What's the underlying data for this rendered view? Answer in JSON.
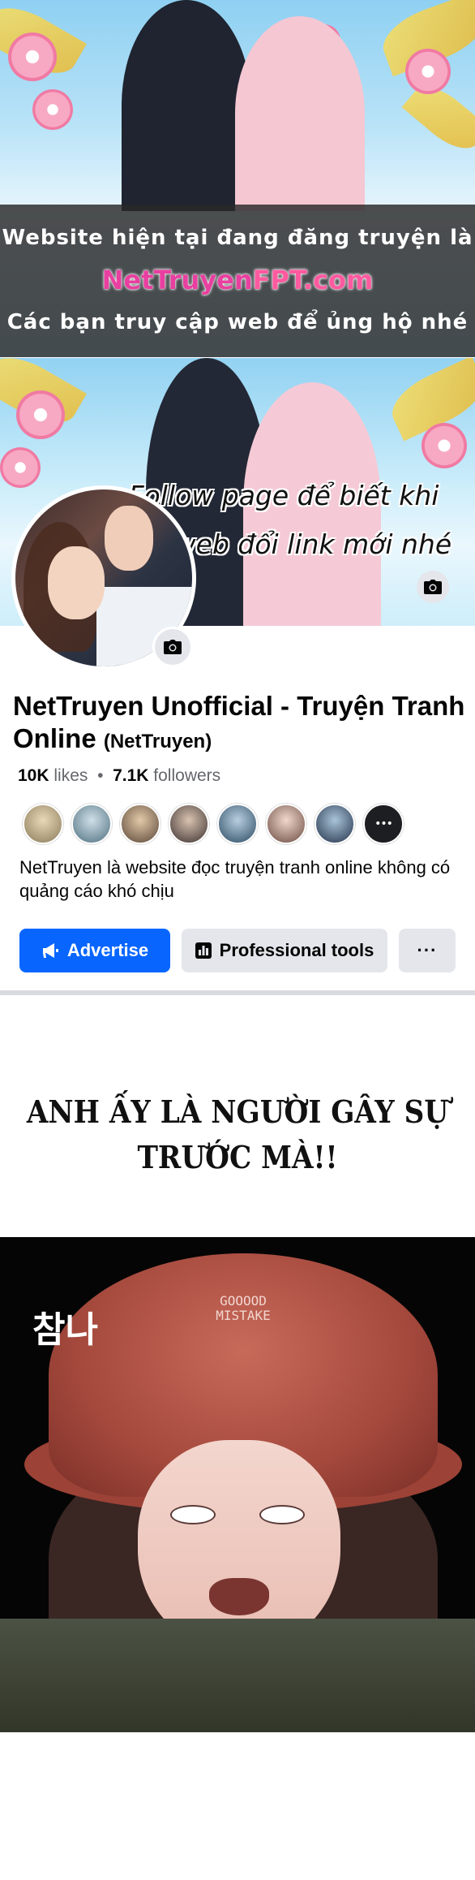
{
  "banner": {
    "line1": "Website hiện tại đang đăng truyện là",
    "brand_part1": "NetTruyen",
    "brand_part2": "FPT.com",
    "line3": "Các bạn truy cập web để ủng hộ nhé"
  },
  "fb_card": {
    "cover_text_line1": "Follow page để biết khi",
    "cover_text_line2": "nào web đổi link mới nhé",
    "page_name": "NetTruyen Unofficial - Truyện Tranh Online",
    "page_handle": "(NetTruyen)",
    "likes_count": "10K",
    "likes_label": "likes",
    "separator": "•",
    "followers_count": "7.1K",
    "followers_label": "followers",
    "more_friends_glyph": "•••",
    "bio": "NetTruyen là website đọc truyện tranh online không có quảng cáo khó chịu",
    "advertise_label": "Advertise",
    "professional_tools_label": "Professional tools",
    "more_glyph": "···",
    "brand_color": "#0866ff"
  },
  "comic": {
    "speech_line1": "ANH ẤY LÀ NGƯỜI GÂY SỰ",
    "speech_line2": "TRƯỚC MÀ!!",
    "sfx": "참나",
    "hat_text_line1": "GOOOOD",
    "hat_text_line2": "MISTAKE"
  }
}
